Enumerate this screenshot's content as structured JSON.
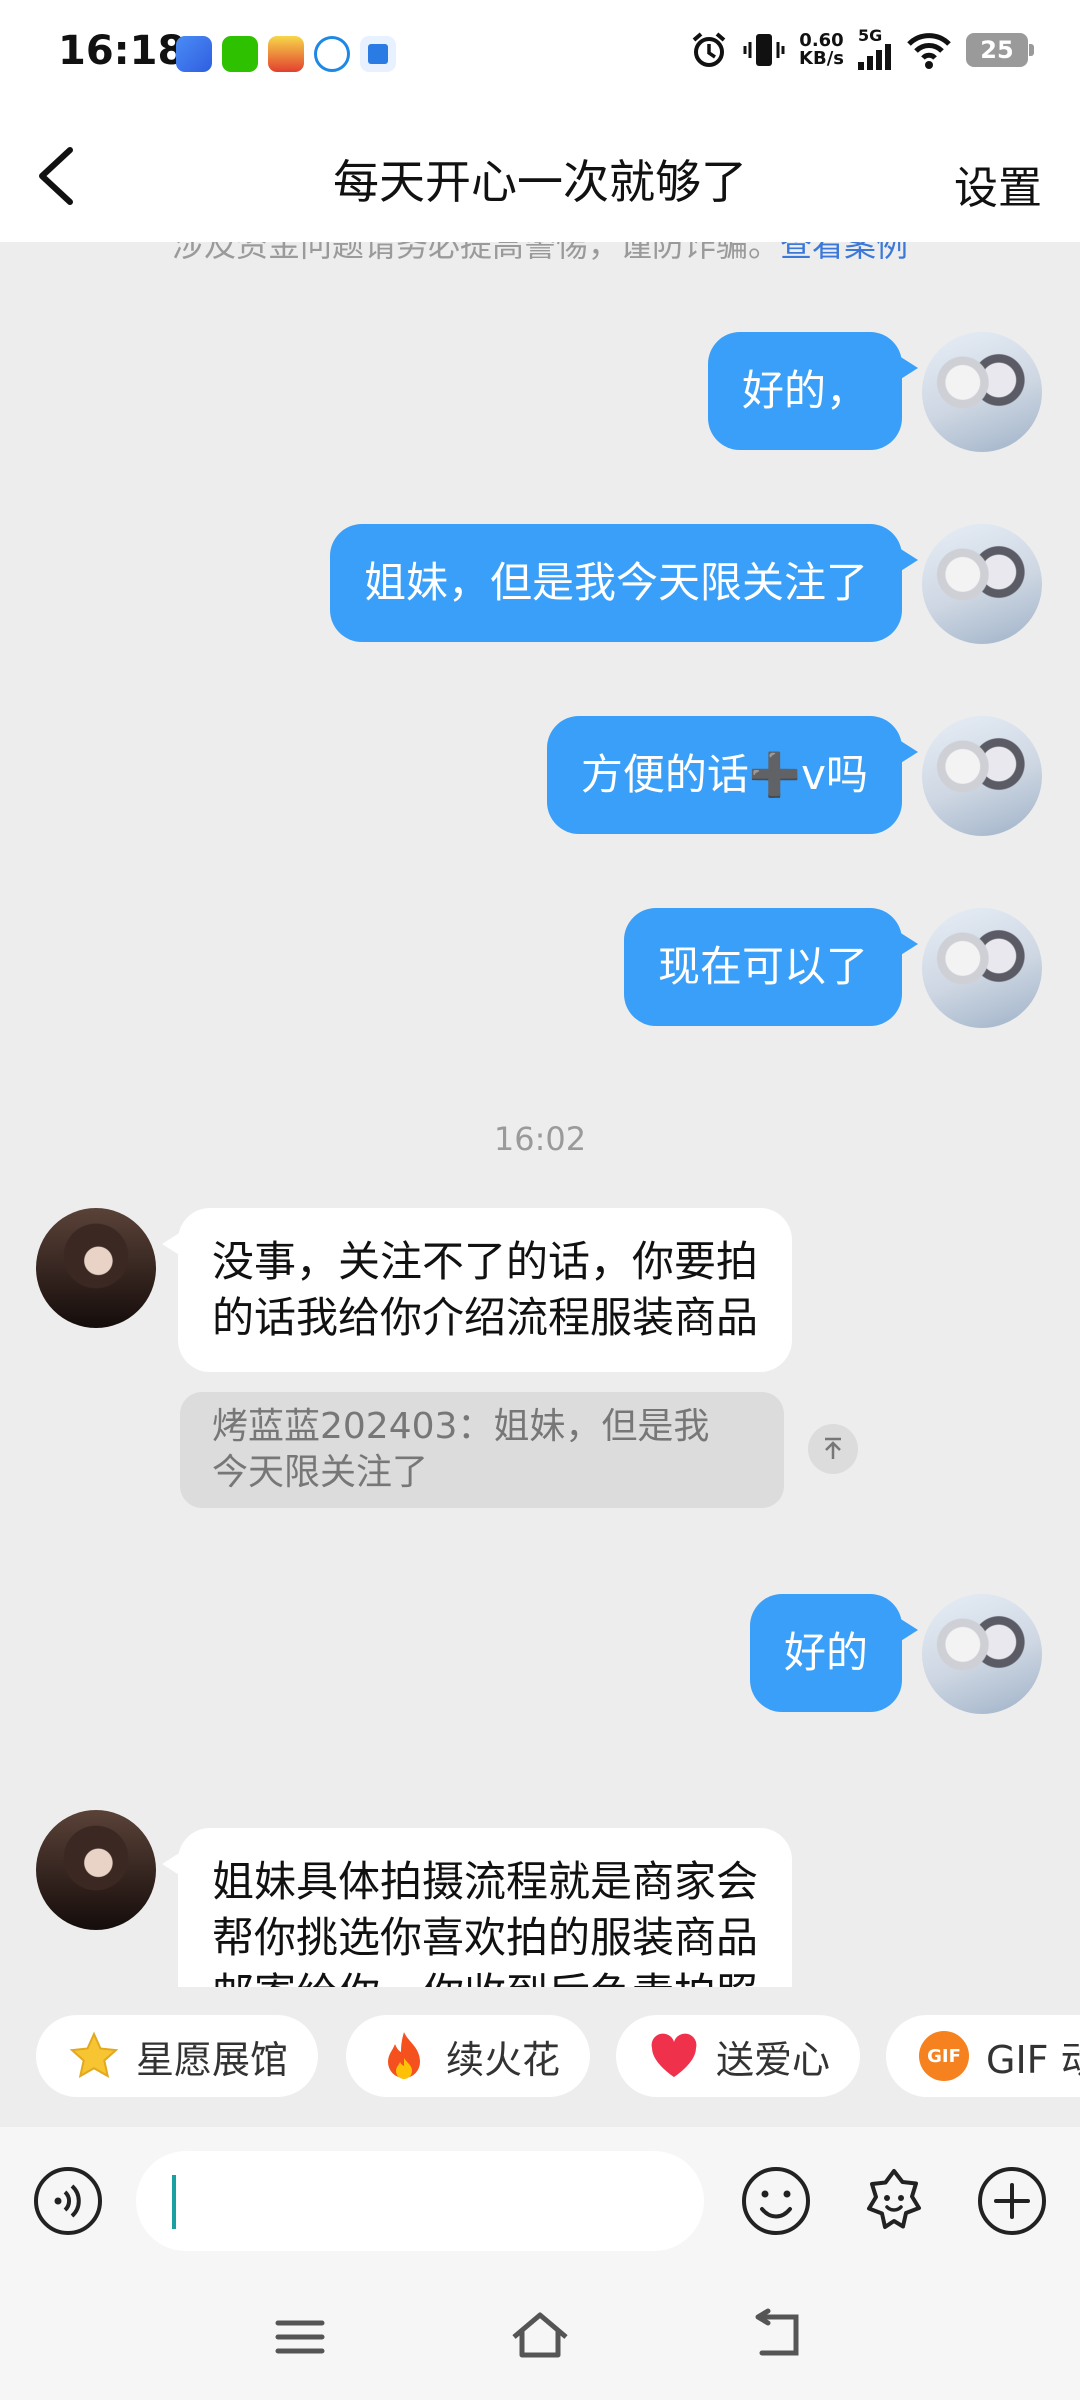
{
  "status_bar": {
    "time": "16:18",
    "speed_value": "0.60",
    "speed_unit": "KB/s",
    "network": "5G",
    "battery": "25",
    "icons": [
      "browser-icon",
      "wechat-icon",
      "app-red-icon",
      "app-blue-icon",
      "app-square-icon",
      "alarm-icon",
      "vibrate-icon",
      "signal-icon",
      "wifi-icon",
      "battery-icon"
    ]
  },
  "header": {
    "title": "每天开心一次就够了",
    "settings_label": "设置",
    "back_icon": "chevron-left-icon"
  },
  "chat": {
    "warning_text": "涉及资金问题请务必提高警惕，谨防诈骗。",
    "warning_link": "查看案例",
    "messages": [
      {
        "side": "out",
        "text": "好的，"
      },
      {
        "side": "out",
        "text": "姐妹，但是我今天限关注了"
      },
      {
        "side": "out",
        "text": "方便的话➕v吗"
      },
      {
        "side": "out",
        "text": "现在可以了"
      },
      {
        "side": "timestamp",
        "text": "16:02"
      },
      {
        "side": "in",
        "line1": "没事，关注不了的话，你要拍",
        "line2": "的话我给你介绍流程服装商品"
      },
      {
        "side": "quote",
        "line1": "烤蓝蓝202403：姐妹，但是我",
        "line2": "今天限关注了"
      },
      {
        "side": "out",
        "text": "好的"
      },
      {
        "side": "in",
        "line1": "姐妹具体拍摄流程就是商家会",
        "line2": "帮你挑选你喜欢拍的服装商品",
        "line3": "邮寄给你，你收到后负责拍照"
      }
    ]
  },
  "quick_actions": [
    {
      "label": "星愿展馆",
      "icon": "star-icon"
    },
    {
      "label": "续火花",
      "icon": "fire-icon"
    },
    {
      "label": "送爱心",
      "icon": "heart-icon"
    },
    {
      "label": "GIF 动",
      "icon": "gif-icon",
      "icon_text": "GIF"
    }
  ],
  "input_bar": {
    "value": "",
    "icons": [
      "voice-icon",
      "emoji-icon",
      "sticker-icon",
      "plus-icon"
    ]
  },
  "nav_bar": {
    "icons": [
      "menu-icon",
      "home-icon",
      "back-icon"
    ]
  },
  "colors": {
    "outgoing_bubble": "#3a9ff8",
    "incoming_bubble": "#ffffff",
    "background": "#ededed",
    "link": "#3c78d8"
  }
}
